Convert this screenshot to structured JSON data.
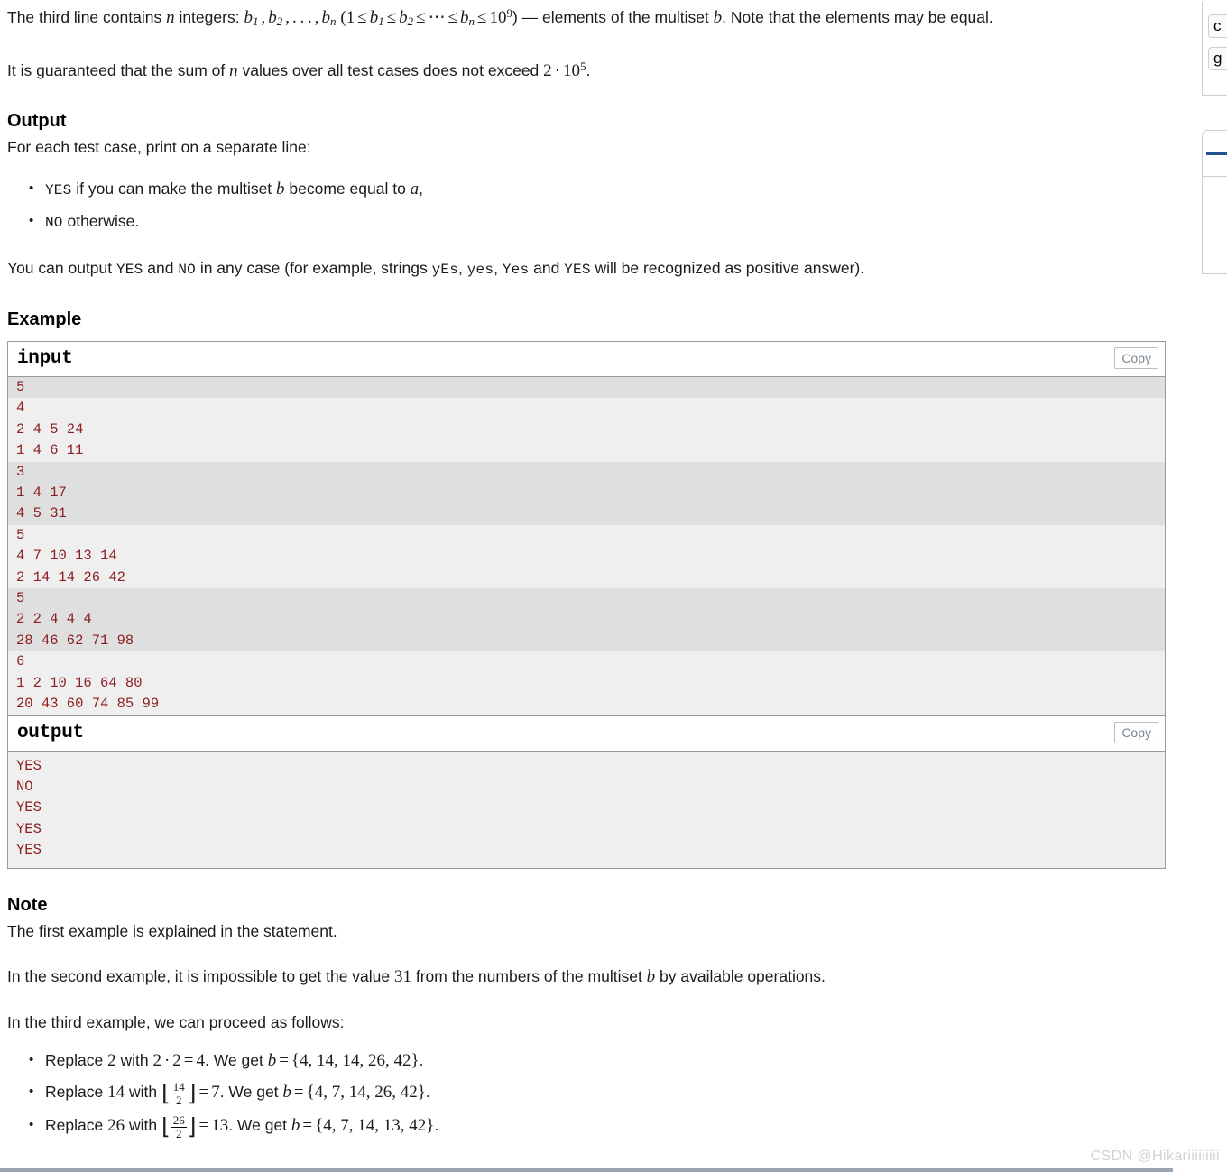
{
  "statement": {
    "third_line": {
      "lead": "The third line contains ",
      "var_n": "n",
      "mid": " integers: ",
      "b_list": "b₁, b₂, …, bₙ",
      "constraint_open": "(1",
      "constraint": "1 ≤ b₁ ≤ b₂ ≤ ⋯ ≤ bₙ ≤ 10⁹",
      "tail": ") — elements of the multiset ",
      "var_b": "b",
      "tail2": ". Note that the elements may be equal."
    },
    "guarantee": {
      "prefix": "It is guaranteed that the sum of ",
      "var_n": "n",
      "middle": " values over all test cases does not exceed ",
      "bound": "2 · 10⁵",
      "period": "."
    }
  },
  "output_section": {
    "heading": "Output",
    "intro": "For each test case, print on a separate line:",
    "bullets": [
      {
        "code": "YES",
        "text_before": "",
        "text_after": " if you can make the multiset ",
        "var1": "b",
        "text_mid": " become equal to ",
        "var2": "a",
        "text_end": ","
      },
      {
        "code": "NO",
        "text_before": "",
        "text_after": " otherwise.",
        "var1": "",
        "text_mid": "",
        "var2": "",
        "text_end": ""
      }
    ],
    "any_case": {
      "p1": "You can output ",
      "c1": "YES",
      "p2": " and ",
      "c2": "NO",
      "p3": " in any case (for example, strings ",
      "c3": "yEs",
      "p4": ", ",
      "c4": "yes",
      "p5": ", ",
      "c5": "Yes",
      "p6": " and ",
      "c6": "YES",
      "p7": " will be recognized as positive answer)."
    }
  },
  "example_section": {
    "heading": "Example",
    "input_block": {
      "title": "input",
      "copy_label": "Copy",
      "test_groups": [
        {
          "lines": [
            "5"
          ]
        },
        {
          "lines": [
            "4",
            "2 4 5 24",
            "1 4 6 11"
          ]
        },
        {
          "lines": [
            "3",
            "1 4 17",
            "4 5 31"
          ]
        },
        {
          "lines": [
            "5",
            "4 7 10 13 14",
            "2 14 14 26 42"
          ]
        },
        {
          "lines": [
            "5",
            "2 2 4 4 4",
            "28 46 62 71 98"
          ]
        },
        {
          "lines": [
            "6",
            "1 2 10 16 64 80",
            "20 43 60 74 85 99"
          ]
        }
      ]
    },
    "output_block": {
      "title": "output",
      "copy_label": "Copy",
      "lines": [
        "YES",
        "NO",
        "YES",
        "YES",
        "YES"
      ]
    }
  },
  "note_section": {
    "heading": "Note",
    "first": "The first example is explained in the statement.",
    "second": {
      "p1": "In the second example, it is impossible to get the value ",
      "num": "31",
      "p2": " from the numbers of the multiset ",
      "var": "b",
      "p3": " by available operations."
    },
    "third_intro": "In the third example, we can proceed as follows:",
    "steps": [
      {
        "label_before": "Replace ",
        "from": "2",
        "label_with": " with ",
        "expr": "2 · 2",
        "equals": "=",
        "result": "4",
        "label_get": ". We get ",
        "var": "b",
        "eq2": "=",
        "set": "{4, 14, 14, 26, 42}",
        "period": ".",
        "kind": "multiply",
        "frac_num": "",
        "frac_den": ""
      },
      {
        "label_before": "Replace ",
        "from": "14",
        "label_with": " with ",
        "expr": "",
        "equals": "=",
        "result": "7",
        "label_get": ". We get ",
        "var": "b",
        "eq2": "=",
        "set": "{4, 7, 14, 26, 42}",
        "period": ".",
        "kind": "floor",
        "frac_num": "14",
        "frac_den": "2"
      },
      {
        "label_before": "Replace ",
        "from": "26",
        "label_with": " with ",
        "expr": "",
        "equals": "=",
        "result": "13",
        "label_get": ". We get ",
        "var": "b",
        "eq2": "=",
        "set": "{4, 7, 14, 13, 42}",
        "period": ".",
        "kind": "floor",
        "frac_num": "26",
        "frac_den": "2"
      }
    ]
  },
  "side_rail": {
    "tag_chips": [
      "c",
      "g"
    ],
    "panel_accent": "#26538f"
  },
  "watermark": "CSDN @Hikariiiiiiiii",
  "colors": {
    "sample_text": "#8c2022",
    "stripe_dark": "#dfdfdf",
    "stripe_light": "#efefef",
    "border": "#999a9a",
    "copy_text": "#7a8793"
  }
}
